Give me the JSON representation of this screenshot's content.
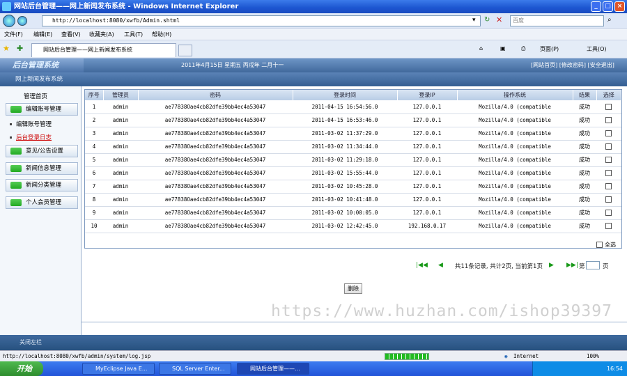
{
  "window": {
    "title": "网站后台管理——网上新闻发布系统 - Windows Internet Explorer",
    "min": "_",
    "max": "□",
    "close": "×"
  },
  "browser": {
    "address": "http://localhost:8080/xwfb/Admin.shtml",
    "search_placeholder": "百度",
    "menu": [
      "文件(F)",
      "编辑(E)",
      "查看(V)",
      "收藏夹(A)",
      "工具(T)",
      "帮助(H)"
    ],
    "tab_title": "网站后台管理——网上新闻发布系统",
    "tools_page": "页面(P)",
    "tools_tools": "工具(O)"
  },
  "app": {
    "brand": "后台管理系统",
    "date": "2011年4月15日 星期五 丙戌年 二月十一",
    "links": "[网站首页] [修改密码] [安全退出]",
    "subtitle": "网上新闻发布系统",
    "footer": "关闭左栏"
  },
  "sidebar": {
    "home": "管理首页",
    "items": [
      {
        "label": "编辑账号管理",
        "type": "button"
      },
      {
        "label": "编辑账号管理",
        "type": "link"
      },
      {
        "label": "后台登录日志",
        "type": "link"
      },
      {
        "label": "意见/公告设置",
        "type": "button"
      },
      {
        "label": "新闻信息管理",
        "type": "button"
      },
      {
        "label": "新闻分类管理",
        "type": "button"
      },
      {
        "label": "个人会员管理",
        "type": "button"
      }
    ]
  },
  "table": {
    "headers": [
      "序号",
      "管理员",
      "密码",
      "登录时间",
      "登录IP",
      "操作系统",
      "结果",
      "选择"
    ],
    "rows": [
      [
        "1",
        "admin",
        "ae77838Oae4cb82dfe39bb4ec4a53047",
        "2011-04-15 16:54:56.0",
        "127.0.0.1",
        "Mozilla/4.0 (compatible",
        "成功"
      ],
      [
        "2",
        "admin",
        "ae77838Oae4cb82dfe39bb4ec4a53047",
        "2011-04-15 16:53:46.0",
        "127.0.0.1",
        "Mozilla/4.0 (compatible",
        "成功"
      ],
      [
        "3",
        "admin",
        "ae77838Oae4cb82dfe39bb4ec4a53047",
        "2011-03-02 11:37:29.0",
        "127.0.0.1",
        "Mozilla/4.0 (compatible",
        "成功"
      ],
      [
        "4",
        "admin",
        "ae77838Oae4cb82dfe39bb4ec4a53047",
        "2011-03-02 11:34:44.0",
        "127.0.0.1",
        "Mozilla/4.0 (compatible",
        "成功"
      ],
      [
        "5",
        "admin",
        "ae77838Oae4cb82dfe39bb4ec4a53047",
        "2011-03-02 11:29:18.0",
        "127.0.0.1",
        "Mozilla/4.0 (compatible",
        "成功"
      ],
      [
        "6",
        "admin",
        "ae77838Oae4cb82dfe39bb4ec4a53047",
        "2011-03-02 15:55:44.0",
        "127.0.0.1",
        "Mozilla/4.0 (compatible",
        "成功"
      ],
      [
        "7",
        "admin",
        "ae77838Oae4cb82dfe39bb4ec4a53047",
        "2011-03-02 10:45:28.0",
        "127.0.0.1",
        "Mozilla/4.0 (compatible",
        "成功"
      ],
      [
        "8",
        "admin",
        "ae77838Oae4cb82dfe39bb4ec4a53047",
        "2011-03-02 10:41:48.0",
        "127.0.0.1",
        "Mozilla/4.0 (compatible",
        "成功"
      ],
      [
        "9",
        "admin",
        "ae77838Oae4cb82dfe39bb4ec4a53047",
        "2011-03-02 10:00:05.0",
        "127.0.0.1",
        "Mozilla/4.0 (compatible",
        "成功"
      ],
      [
        "10",
        "admin",
        "ae77838Oae4cb82dfe39bb4ec4a53047",
        "2011-03-02 12:42:45.0",
        "192.168.0.17",
        "Mozilla/4.0 (compatible",
        "成功"
      ]
    ],
    "select_all": "全选"
  },
  "pager": {
    "summary": "共11条记录, 共计2页, 当前第1页",
    "goto_prefix": "第",
    "goto_suffix": "页",
    "first": "|◀◀",
    "prev": "◀",
    "next": "▶",
    "last": "▶▶|"
  },
  "delete_label": "删除",
  "watermark": "https://www.huzhan.com/ishop39397",
  "statusbar": {
    "url": "http://localhost:8080/xwfb/admin/system/log.jsp",
    "zone": "Internet",
    "zoom": "100%"
  },
  "taskbar": {
    "start": "开始",
    "tasks": [
      "MyEclipse Java E...",
      "SQL Server Enter...",
      "网站后台管理——..."
    ],
    "clock": "16:54"
  },
  "colors": {
    "header_blue": "#41699c",
    "accent_green": "#2a2",
    "taskbar_blue": "#2154d8"
  }
}
